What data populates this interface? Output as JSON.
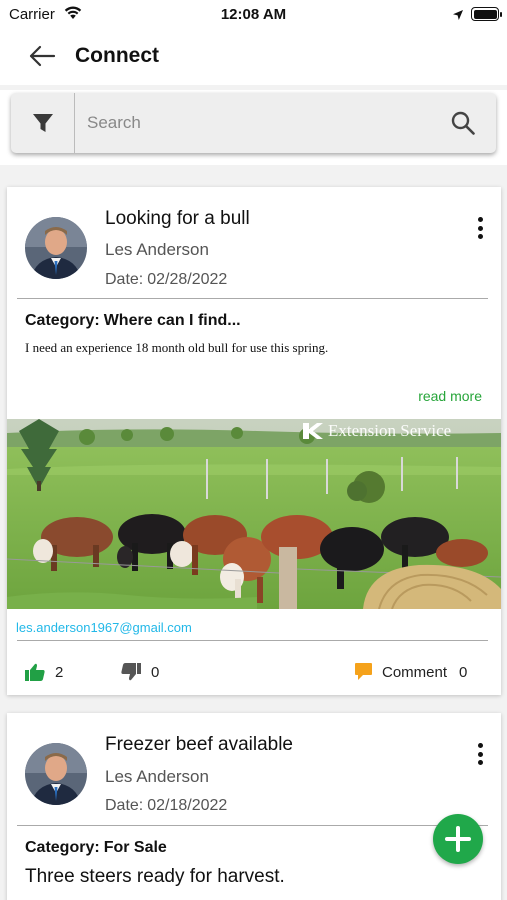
{
  "status_bar": {
    "carrier": "Carrier",
    "time": "12:08 AM"
  },
  "header": {
    "title": "Connect",
    "back_icon": "arrow-left-icon"
  },
  "search": {
    "placeholder": "Search",
    "filter_icon": "filter-icon",
    "search_icon": "search-icon"
  },
  "posts": [
    {
      "title": "Looking for a bull",
      "author": "Les Anderson",
      "date_label": "Date:",
      "date": "02/28/2022",
      "category_label": "Category:",
      "category": "Where can I find...",
      "description": "I need an experience 18 month old bull for use this spring.",
      "read_more": "read more",
      "image_caption": "Extension Service",
      "email": "les.anderson1967@gmail.com",
      "likes": "2",
      "dislikes": "0",
      "comment_label": "Comment",
      "comments": "0"
    },
    {
      "title": "Freezer beef available",
      "author": "Les Anderson",
      "date_label": "Date:",
      "date": "02/18/2022",
      "category_label": "Category:",
      "category": "For Sale",
      "description": "Three steers ready for harvest."
    }
  ],
  "colors": {
    "accent_green": "#20a84a",
    "link_green": "#27a53a",
    "email_blue": "#22b8e8",
    "comment_orange": "#f5a21b"
  }
}
